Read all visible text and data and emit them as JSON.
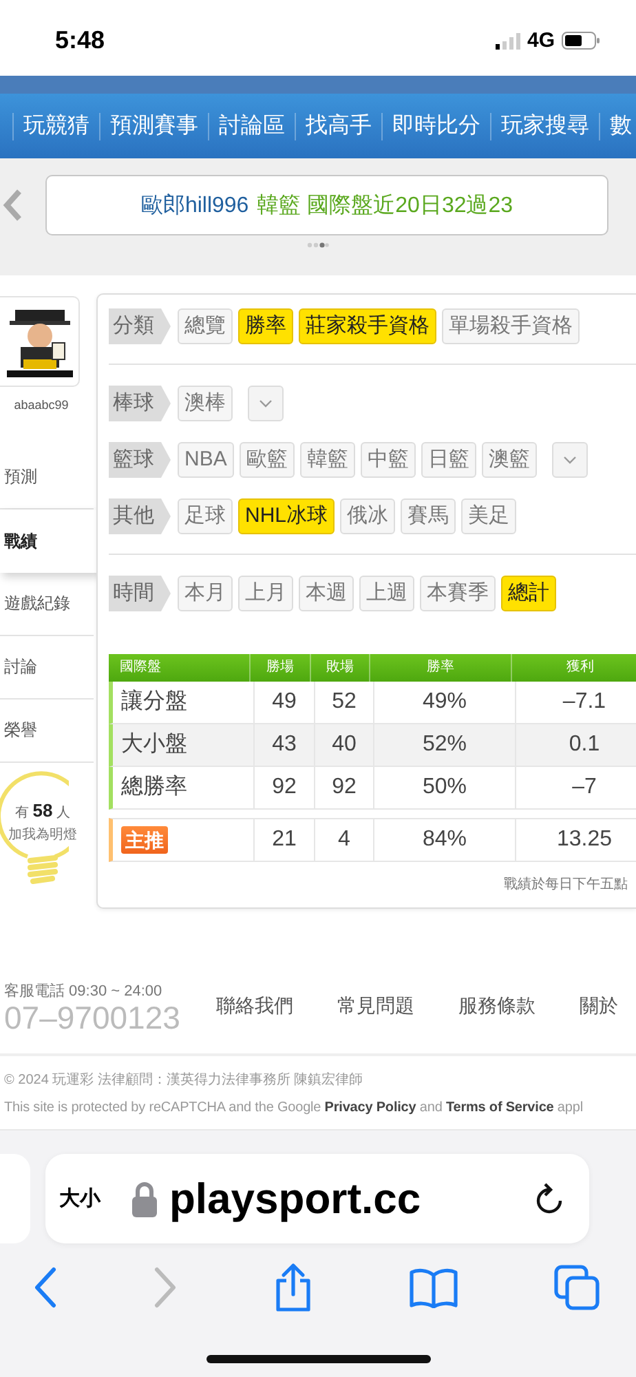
{
  "status_bar": {
    "time": "5:48",
    "network": "4G"
  },
  "nav": {
    "items": [
      "玩競猜",
      "預測賽事",
      "討論區",
      "找高手",
      "即時比分",
      "玩家搜尋",
      "數"
    ]
  },
  "banner": {
    "user": "歐郎hill996",
    "text": "韓籃 國際盤近20日32過23"
  },
  "sidebar": {
    "username": "abaabc99",
    "items": [
      {
        "label": "預測",
        "selected": false
      },
      {
        "label": "戰績",
        "selected": true
      },
      {
        "label": "遊戲紀錄",
        "selected": false
      },
      {
        "label": "討論",
        "selected": false
      },
      {
        "label": "榮譽",
        "selected": false
      }
    ],
    "fans": {
      "text": "有 **58** 人",
      "caption": "加我為明燈"
    }
  },
  "filters": [
    {
      "rows": [
        {
          "label": "分類",
          "dropdown": false,
          "options": [
            {
              "label": "總覽",
              "selected": false
            },
            {
              "label": "勝率",
              "selected": true
            },
            {
              "label": "莊家殺手資格",
              "selected": true
            },
            {
              "label": "單場殺手資格",
              "selected": false
            }
          ]
        }
      ]
    },
    {
      "rows": [
        {
          "label": "棒球",
          "dropdown": true,
          "options": [
            {
              "label": "澳棒",
              "selected": false
            }
          ]
        },
        {
          "label": "籃球",
          "dropdown": true,
          "options": [
            {
              "label": "NBA",
              "selected": false
            },
            {
              "label": "歐籃",
              "selected": false
            },
            {
              "label": "韓籃",
              "selected": false
            },
            {
              "label": "中籃",
              "selected": false
            },
            {
              "label": "日籃",
              "selected": false
            },
            {
              "label": "澳籃",
              "selected": false
            }
          ]
        },
        {
          "label": "其他",
          "dropdown": false,
          "options": [
            {
              "label": "足球",
              "selected": false
            },
            {
              "label": "NHL冰球",
              "selected": true
            },
            {
              "label": "俄冰",
              "selected": false
            },
            {
              "label": "賽馬",
              "selected": false
            },
            {
              "label": "美足",
              "selected": false
            }
          ]
        }
      ]
    },
    {
      "rows": [
        {
          "label": "時間",
          "dropdown": false,
          "options": [
            {
              "label": "本月",
              "selected": false
            },
            {
              "label": "上月",
              "selected": false
            },
            {
              "label": "本週",
              "selected": false
            },
            {
              "label": "上週",
              "selected": false
            },
            {
              "label": "本賽季",
              "selected": false
            },
            {
              "label": "總計",
              "selected": true
            }
          ]
        }
      ]
    }
  ],
  "table": {
    "columns": [
      "國際盤",
      "勝場",
      "敗場",
      "勝率",
      "獲利"
    ],
    "rows": [
      {
        "kind": "normal",
        "cells": [
          "讓分盤",
          "49",
          "52",
          "49%",
          "–7.1"
        ]
      },
      {
        "kind": "normal",
        "cells": [
          "大小盤",
          "43",
          "40",
          "52%",
          "0.1"
        ]
      },
      {
        "kind": "normal",
        "cells": [
          "總勝率",
          "92",
          "92",
          "50%",
          "–7"
        ]
      },
      {
        "kind": "featured",
        "cells": [
          "主推",
          "21",
          "4",
          "84%",
          "13.25"
        ]
      }
    ]
  },
  "note": "戰績於每日下午五點",
  "footer": {
    "hotline": "客服電話 09:30 ~ 24:00",
    "phone": "07–9700123",
    "links": [
      "聯絡我們",
      "常見問題",
      "服務條款",
      "關於"
    ],
    "copyright": "© 2024 玩運彩 法律顧問：漢英得力法律事務所 陳鎮宏律師",
    "recaptcha": "This site is protected by reCAPTCHA and the Google **Privacy Policy** and **Terms of Service** appl"
  },
  "browser": {
    "text_size": "大小",
    "url": "playsport.cc"
  }
}
